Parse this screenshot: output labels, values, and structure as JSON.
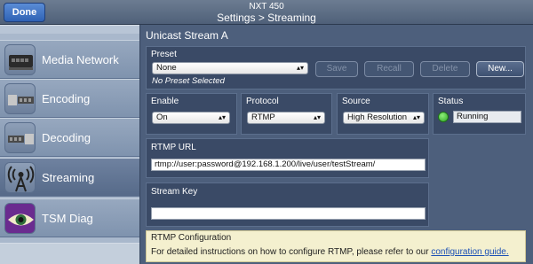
{
  "topbar": {
    "done_label": "Done",
    "device_name": "NXT 450",
    "breadcrumb": "Settings > Streaming"
  },
  "sidebar": {
    "items": [
      {
        "label": "Media Network",
        "icon": "network-switch-icon"
      },
      {
        "label": "Encoding",
        "icon": "encoding-icon"
      },
      {
        "label": "Decoding",
        "icon": "decoding-icon"
      },
      {
        "label": "Streaming",
        "icon": "streaming-antenna-icon",
        "active": true
      },
      {
        "label": "TSM Diag",
        "icon": "tsm-diag-eye-icon"
      }
    ]
  },
  "main": {
    "section_title": "Unicast Stream A",
    "preset": {
      "label": "Preset",
      "value": "None",
      "no_preset_text": "No Preset Selected",
      "buttons": {
        "save": "Save",
        "recall": "Recall",
        "delete": "Delete",
        "new": "New..."
      }
    },
    "enable": {
      "label": "Enable",
      "value": "On"
    },
    "protocol": {
      "label": "Protocol",
      "value": "RTMP"
    },
    "source": {
      "label": "Source",
      "value": "High Resolution"
    },
    "status": {
      "label": "Status",
      "value": "Running",
      "indicator_color": "#3cbc2c"
    },
    "rtmp_url": {
      "label": "RTMP URL",
      "value": "rtmp://user:password@192.168.1.200/live/user/testStream/"
    },
    "stream_key": {
      "label": "Stream Key",
      "value": ""
    },
    "note": {
      "title": "RTMP Configuration",
      "text": "For detailed instructions on how to configure RTMP, please refer to our",
      "link_text": "configuration guide."
    }
  },
  "colors": {
    "topbar": "#5d6d84",
    "done_button": "#3a70c4",
    "sidebar": "#8a9db6",
    "main_bg": "#4d5f7c",
    "box_bg": "#3a4a66",
    "note_bg": "#f4f0cf",
    "link": "#1a4fb5"
  }
}
